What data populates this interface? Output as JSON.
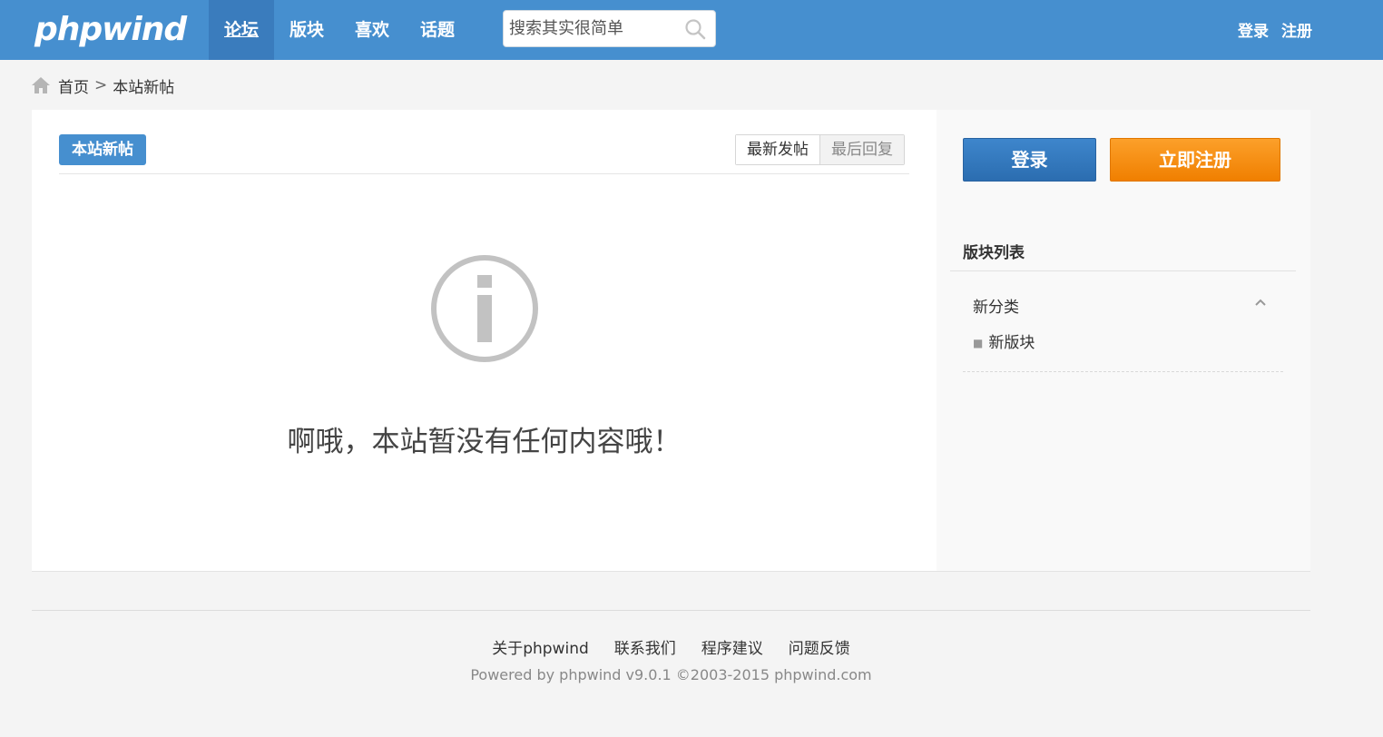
{
  "header": {
    "logo": "phpwind",
    "nav": [
      "论坛",
      "版块",
      "喜欢",
      "话题"
    ],
    "search_placeholder": "搜索其实很简单",
    "login": "登录",
    "register": "注册"
  },
  "breadcrumb": {
    "home": "首页",
    "separator": ">",
    "current": "本站新帖"
  },
  "main": {
    "tab": "本站新帖",
    "sort_latest_post": "最新发帖",
    "sort_last_reply": "最后回复",
    "empty_message": "啊哦，本站暂没有任何内容哦！"
  },
  "sidebar": {
    "login_button": "登录",
    "register_button": "立即注册",
    "section_title": "版块列表",
    "category": "新分类",
    "forum": "新版块"
  },
  "footer": {
    "links": [
      "关于phpwind",
      "联系我们",
      "程序建议",
      "问题反馈"
    ],
    "copyright": "Powered by phpwind v9.0.1 ©2003-2015 phpwind.com"
  },
  "colors": {
    "header_bg": "#468fcf",
    "nav_active_bg": "#3a7cbd",
    "login_blue": "#2f74b8",
    "register_orange": "#f58a0b"
  }
}
